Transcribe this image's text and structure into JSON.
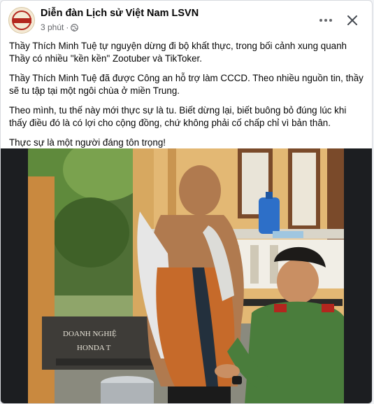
{
  "post": {
    "page_name": "Diễn đàn Lịch sử Việt Nam LSVN",
    "time": "3 phút",
    "dot": "·",
    "paragraphs": [
      "Thầy Thích Minh Tuệ tự nguyện dừng đi bộ khất thực, trong bối cảnh xung quanh Thầy có nhiều \"kền kền\" Zootuber và TikToker.",
      "Thầy Thích Minh Tuệ đã được Công an hỗ trợ làm CCCD. Theo nhiều nguồn tin, thầy sẽ tu tập tại một ngôi chùa ở miền Trung.",
      "Theo mình, tu thế này mới thực sự là tu. Biết dừng lại, biết buông bỏ đúng lúc khi thấy điều đó là có lợi cho cộng đồng, chứ không phải cố chấp chỉ vì bản thân.",
      "Thực sự là một người đáng tôn trọng!"
    ]
  },
  "photo": {
    "sign_line1": "DOANH NGHIỆ",
    "sign_line2": "HONDA T"
  },
  "icons": {
    "avatar": "page-avatar-logo",
    "globe": "globe-icon",
    "more": "more-options-icon",
    "close": "close-icon"
  },
  "colors": {
    "name_text": "#050505",
    "meta_text": "#65676b",
    "uniform": "#4a7d3c",
    "robe": "#c66a2a",
    "wall": "#e3b874"
  }
}
